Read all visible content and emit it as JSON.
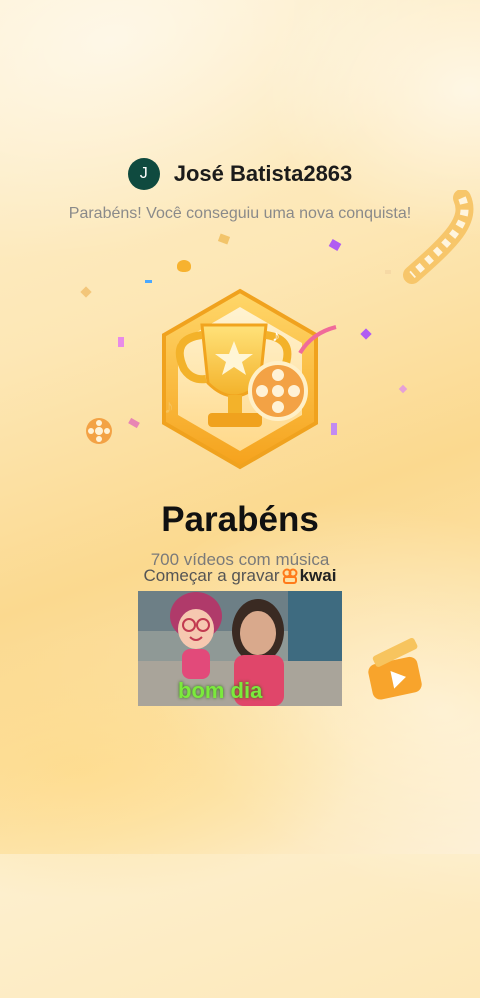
{
  "user": {
    "avatar_initial": "J",
    "name": "José Batista2863"
  },
  "subtitle": "Parabéns! Você conseguiu uma nova conquista!",
  "badge": {
    "icon": "trophy-film-reel-badge"
  },
  "title": "Parabéns",
  "description": "700 vídeos com música",
  "record": {
    "label": "Começar a gravar",
    "brand": "kwai"
  },
  "photo": {
    "caption": "bom dia"
  },
  "colors": {
    "accent": "#f7a81f",
    "brand_orange": "#ff7a1a",
    "avatar_bg": "#0f4a3f"
  }
}
